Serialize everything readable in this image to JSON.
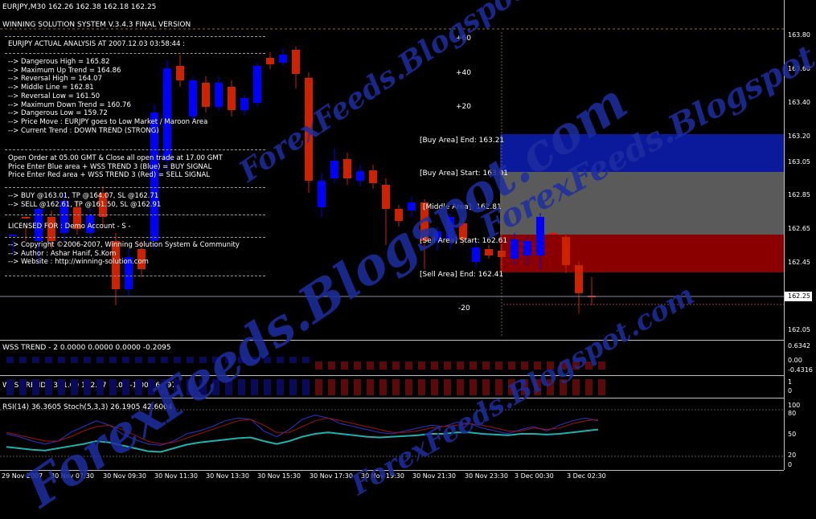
{
  "header": {
    "symbol_line": "EURJPY,M30  162.26 162.38 162.18 162.25",
    "system_title": "WINNING SOLUTION SYSTEM V.3.4.3 FINAL VERSION"
  },
  "analysis": {
    "title": "EURJPY ACTUAL ANALYSIS AT 2007.12.03 03:58:44 :",
    "levels": [
      "--> Dangerous High = 165.82",
      "--> Maximum Up Trend = 164.86",
      "--> Reversal High = 164.07",
      "--> Middle Line = 162.81",
      "--> Reversal Low = 161.50",
      "--> Maximum Down Trend = 160.76",
      "--> Dangerous Low = 159.72",
      "--> Price Move : EURJPY goes to Low Market / Maroon Area",
      "--> Current Trend : DOWN TREND (STRONG)"
    ],
    "orders": [
      "Open Order at 05.00 GMT & Close all open trade at 17.00 GMT",
      "Price Enter Blue area + WSS TREND 3 (Blue) = BUY SIGNAL",
      "Price Enter Red area + WSS TREND 3 (Red) = SELL SIGNAL"
    ],
    "signals": [
      "--> BUY @163.01, TP @164.07, SL @162.71",
      "--> SELL @162.61, TP @161.50, SL @162.91"
    ],
    "license": "LICENSED FOR : Demo Account -          S -",
    "credits": [
      "--> Copyright ©2006-2007, Winning Solution System & Community",
      "--> Author : Ashar Hanif, S.Kom",
      "--> Website : http://winning-solution.com"
    ]
  },
  "areas": {
    "buy_end": "[Buy Area] End: 163.21",
    "buy_start": "[Buy Area] Start: 163.01",
    "middle": "[Middle Area]: 162.81",
    "sell_start": "[Sell Area] Start: 162.61",
    "sell_end": "[Sell Area] End: 162.41"
  },
  "percent_labels": [
    "+60",
    "+40",
    "+20",
    "-20"
  ],
  "price_axis": [
    "163.80",
    "163.60",
    "163.40",
    "163.20",
    "163.05",
    "162.85",
    "162.65",
    "162.45",
    "162.25",
    "162.05"
  ],
  "current_price": "162.25",
  "indicators": {
    "wss2_label": "WSS TREND - 2 0.0000 0.0000 0.0000 -0.2095",
    "wss2_scale": [
      "0.6342",
      "0.00",
      "-0.4316"
    ],
    "wss3_label": "WSS TREND - 3 -1.00 162.97 -1.00 -1.00 162.97",
    "wss3_scale": [
      "1",
      "0"
    ],
    "rsi_label": "RSI(14) 36.3605  Stoch(5,3,3) 26.1905 42.6004",
    "rsi_scale": [
      "100",
      "80",
      "50",
      "20",
      "0"
    ]
  },
  "time_axis": [
    "29 Nov 2007",
    "30 Nov 07:30",
    "30 Nov 09:30",
    "30 Nov 11:30",
    "30 Nov 13:30",
    "30 Nov 15:30",
    "30 Nov 17:30",
    "30 Nov 19:30",
    "30 Nov 21:30",
    "30 Nov 23:30",
    "3 Dec 00:30",
    "3 Dec 02:30"
  ],
  "watermarks": [
    "ForexFeeds.Blogspot.com",
    "ForexFeeds.Blogspot.com",
    "ForexFeeds.Blogspot.com",
    "ForexFeeds.Blogspot.com"
  ],
  "colors": {
    "bull": "#0000ff",
    "bear": "#cc2200",
    "buy_area": "#0a1a9a",
    "middle_area": "#5a5a5a",
    "sell_area": "#8a0000",
    "watermark": "#1e2ea0"
  }
}
